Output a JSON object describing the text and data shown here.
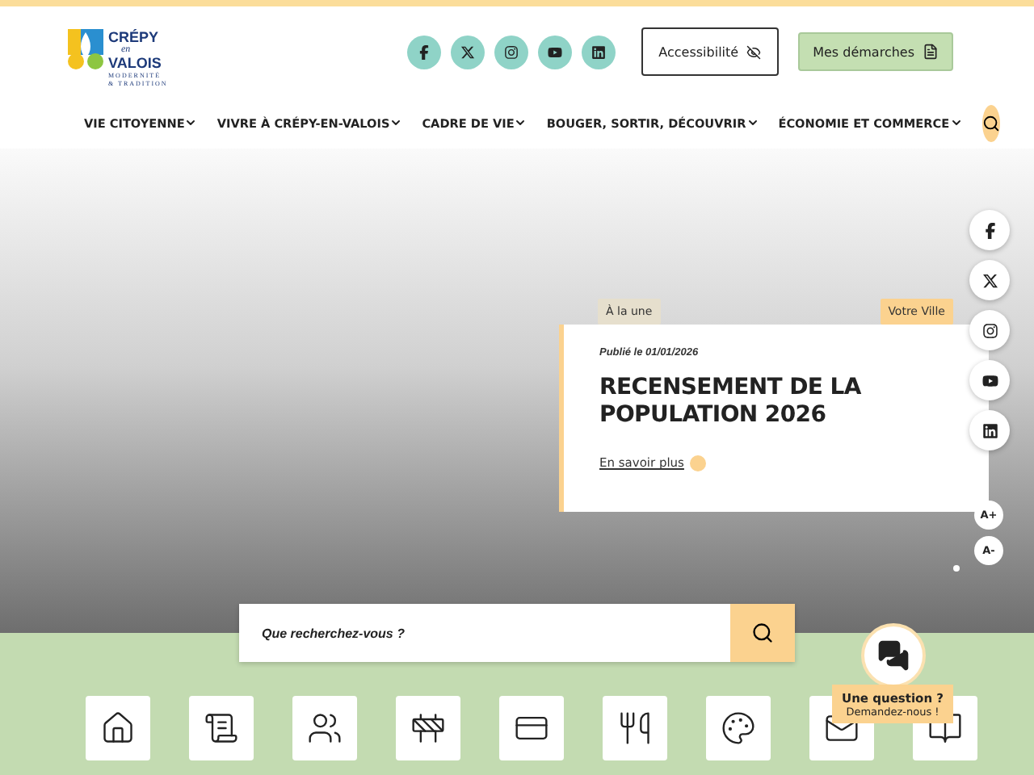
{
  "logo": {
    "line_1": "CRÉPY",
    "line_2": "en",
    "line_3": "VALOIS",
    "tagline_1": "MODERNITÉ",
    "tagline_2": "& TRADITION"
  },
  "header_social": [
    {
      "kind": "facebook"
    },
    {
      "kind": "x"
    },
    {
      "kind": "instagram"
    },
    {
      "kind": "youtube"
    },
    {
      "kind": "linkedin"
    }
  ],
  "accessibility_button": "Accessibilité",
  "procedures_button": "Mes démarches",
  "nav": [
    {
      "label": "VIE CITOYENNE"
    },
    {
      "label": "VIVRE À CRÉPY-EN-VALOIS"
    },
    {
      "label": "CADRE DE VIE"
    },
    {
      "label": "BOUGER, SORTIR, DÉCOUVRIR"
    },
    {
      "label": "ÉCONOMIE ET COMMERCE"
    }
  ],
  "news_card": {
    "tag": "À la une",
    "category": "Votre Ville",
    "date": "Publié le 01/01/2026",
    "title": "RECENSEMENT DE LA POPULATION 2026",
    "link": "En savoir plus"
  },
  "side_social": [
    {
      "kind": "facebook"
    },
    {
      "kind": "x"
    },
    {
      "kind": "instagram"
    },
    {
      "kind": "youtube"
    },
    {
      "kind": "linkedin"
    }
  ],
  "font_size_buttons": [
    "A+",
    "A-"
  ],
  "search": {
    "placeholder": "Que recherchez-vous ?"
  },
  "quick_links": [
    {
      "kind": "home"
    },
    {
      "kind": "scroll"
    },
    {
      "kind": "family"
    },
    {
      "kind": "cone"
    },
    {
      "kind": "card"
    },
    {
      "kind": "utensils"
    },
    {
      "kind": "crafts"
    },
    {
      "kind": "mail"
    },
    {
      "kind": "book"
    }
  ],
  "chat": {
    "title": "Une question ?",
    "subtitle": "Demandez-nous !"
  }
}
